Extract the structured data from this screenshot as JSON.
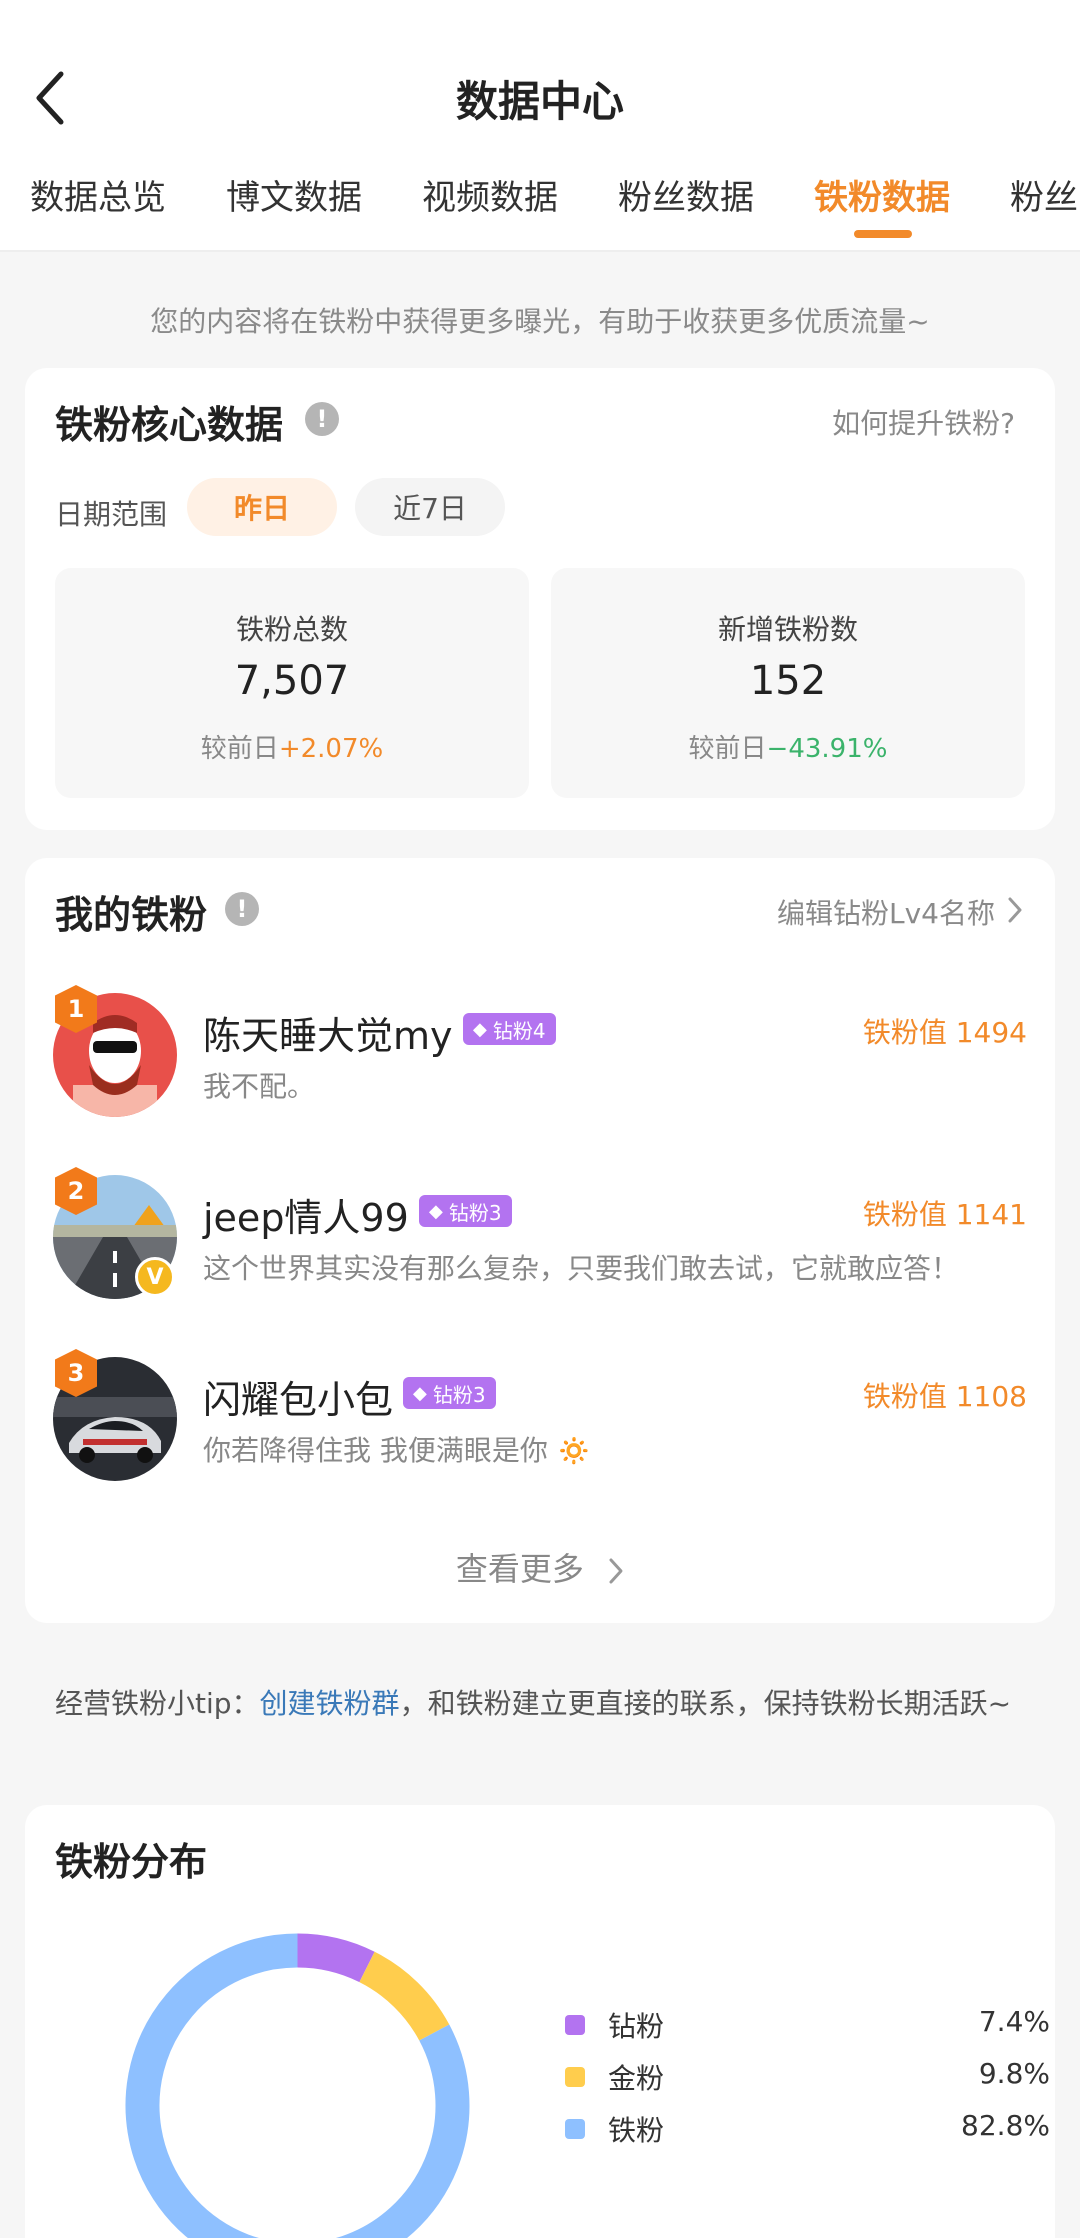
{
  "header": {
    "title": "数据中心",
    "tabs": [
      {
        "label": "数据总览",
        "active": false
      },
      {
        "label": "博文数据",
        "active": false
      },
      {
        "label": "视频数据",
        "active": false
      },
      {
        "label": "粉丝数据",
        "active": false
      },
      {
        "label": "铁粉数据",
        "active": true
      },
      {
        "label": "粉丝",
        "active": false
      }
    ]
  },
  "notice": "您的内容将在铁粉中获得更多曝光，有助于收获更多优质流量~",
  "core": {
    "title": "铁粉核心数据",
    "help_link": "如何提升铁粉?",
    "date_label": "日期范围",
    "date_options": [
      "昨日",
      "近7日"
    ],
    "stats": [
      {
        "label": "铁粉总数",
        "value": "7,507",
        "compare": "较前日",
        "change": "+2.07%"
      },
      {
        "label": "新增铁粉数",
        "value": "152",
        "compare": "较前日",
        "change": "−43.91%"
      }
    ]
  },
  "my_fans": {
    "title": "我的铁粉",
    "edit_link": "编辑钻粉Lv4名称",
    "fans": [
      {
        "rank": "1",
        "name": "陈天睡大觉my",
        "tag": "钻粉4",
        "desc": "我不配。",
        "score": "铁粉值 1494",
        "verified": false
      },
      {
        "rank": "2",
        "name": "jeep情人99",
        "tag": "钻粉3",
        "desc": "这个世界其实没有那么复杂，只要我们敢去试，它就敢应答！",
        "score": "铁粉值 1141",
        "verified": true
      },
      {
        "rank": "3",
        "name": "闪耀包小包",
        "tag": "钻粉3",
        "desc": "你若降得住我 我便满眼是你 🔅",
        "score": "铁粉值 1108",
        "verified": false
      }
    ],
    "more": "查看更多"
  },
  "tip": {
    "prefix": "经营铁粉小tip：",
    "link": "创建铁粉群",
    "suffix": "，和铁粉建立更直接的联系，保持铁粉长期活跃~"
  },
  "distribution": {
    "title": "铁粉分布"
  },
  "chart_data": {
    "type": "pie",
    "title": "铁粉分布",
    "categories": [
      "钻粉",
      "金粉",
      "铁粉"
    ],
    "values": [
      7.4,
      9.8,
      82.8
    ],
    "labels": [
      "7.4%",
      "9.8%",
      "82.8%"
    ],
    "colors": [
      "#b373f0",
      "#ffcd4d",
      "#8ec0ff"
    ],
    "legend": "right"
  }
}
